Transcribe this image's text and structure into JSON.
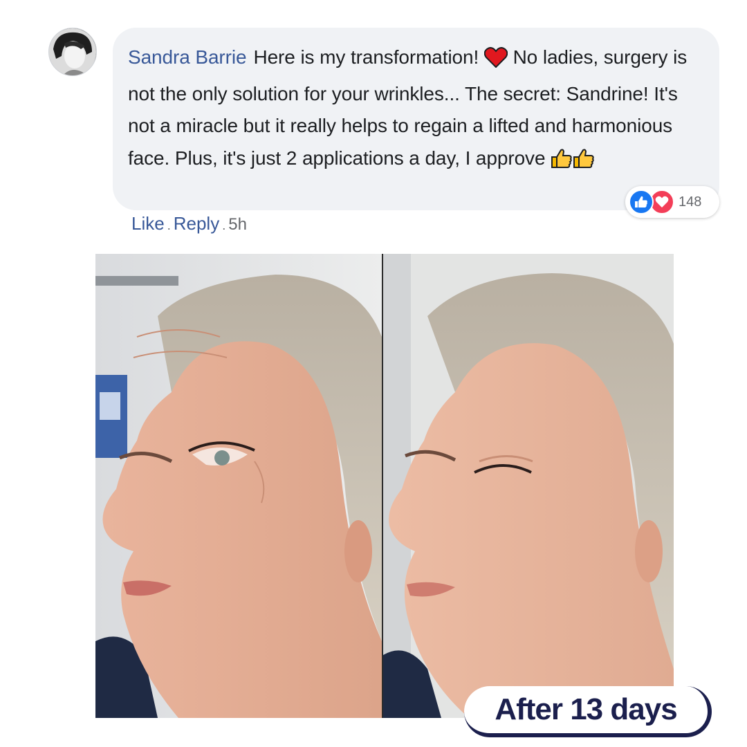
{
  "comment": {
    "author": "Sandra Barrie",
    "text_before_heart": "Here is my transformation!",
    "text_after_heart": "No ladies, surgery is not the only solution for your wrinkles... The secret: Sandrine! It's not a miracle but it really helps to regain a lifted and harmonious face. Plus, it's just 2 applications a day, I approve",
    "emojis": [
      "red-heart-icon",
      "thumbs-up-icon",
      "thumbs-up-icon"
    ]
  },
  "reactions": {
    "icons": [
      "like-reaction-icon",
      "love-reaction-icon"
    ],
    "count": "148"
  },
  "actions": {
    "like": "Like",
    "separator": ".",
    "reply": "Reply",
    "time": "5h"
  },
  "photo": {
    "panels": [
      "before",
      "after"
    ]
  },
  "badge": {
    "label": "After 13 days"
  },
  "colors": {
    "author": "#385898",
    "bubble": "#f0f2f5",
    "like": "#1877f2",
    "love": "#f33e58",
    "badge_text": "#1b1f4d"
  }
}
